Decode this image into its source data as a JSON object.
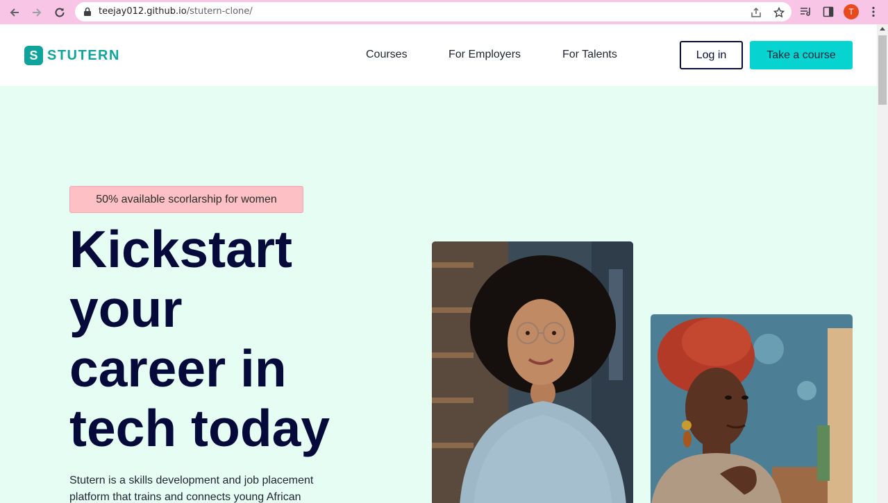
{
  "browser": {
    "url_host": "teejay012.github.io",
    "url_path": "/stutern-clone/",
    "profile_initial": "T"
  },
  "site": {
    "logo_letter": "S",
    "logo_text": "STUTERN",
    "nav": [
      {
        "label": "Courses"
      },
      {
        "label": "For Employers"
      },
      {
        "label": "For Talents"
      }
    ],
    "login_label": "Log in",
    "cta_label": "Take a course"
  },
  "hero": {
    "badge": "50% available scorlarship for women",
    "title_lines": [
      "Kickstart",
      "your",
      "career in",
      "tech today"
    ],
    "description": "Stutern is a skills development and job placement platform that trains and connects young African"
  },
  "colors": {
    "brand_teal": "#0fa39b",
    "cta_cyan": "#07d3d0",
    "navy": "#050a3b",
    "hero_bg": "#e6fdf4",
    "badge_pink": "#fdc1c5",
    "chrome_pink": "#f9c5e6"
  }
}
